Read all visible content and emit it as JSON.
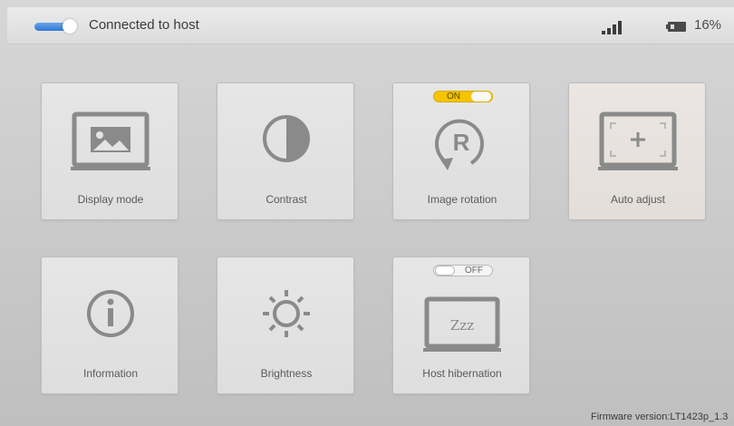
{
  "header": {
    "connection_status": "Connected to host",
    "battery_percent": "16%",
    "signal_icon": "signal-bars-icon",
    "battery_icon": "battery-icon",
    "toggle_color": "#2f78d2"
  },
  "tiles": [
    {
      "label": "Display mode",
      "icon": "display-mode-icon"
    },
    {
      "label": "Contrast",
      "icon": "contrast-icon"
    },
    {
      "label": "Image rotation",
      "icon": "rotation-icon",
      "toggle": "ON",
      "toggle_state": true
    },
    {
      "label": "Auto adjust",
      "icon": "auto-adjust-icon"
    },
    {
      "label": "Information",
      "icon": "info-icon"
    },
    {
      "label": "Brightness",
      "icon": "brightness-icon"
    },
    {
      "label": "Host hibernation",
      "icon": "hibernation-icon",
      "toggle": "OFF",
      "toggle_state": false,
      "icon_text": "Zzz"
    }
  ],
  "footer": {
    "firmware": "Firmware version:LT1423p_1.3"
  },
  "colors": {
    "on_toggle": "#f5c300",
    "icon_gray": "#8a8a8a"
  }
}
